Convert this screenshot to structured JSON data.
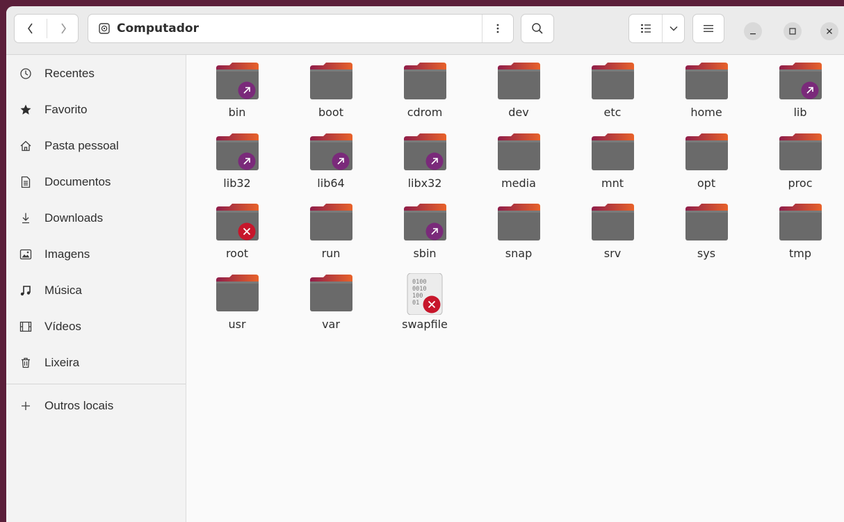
{
  "window": {
    "title": "Computador"
  },
  "header": {
    "back_icon": "chevron-left-icon",
    "forward_icon": "chevron-right-icon",
    "location_icon": "drive-icon",
    "title": "Computador",
    "more_icon": "kebab-menu-icon",
    "search_icon": "search-icon",
    "view_icon": "list-view-icon",
    "view_dropdown_icon": "chevron-down-icon",
    "menu_icon": "hamburger-menu-icon",
    "minimize_icon": "minimize-icon",
    "maximize_icon": "maximize-icon",
    "close_icon": "close-icon"
  },
  "sidebar": {
    "items": [
      {
        "label": "Recentes",
        "icon": "clock-icon"
      },
      {
        "label": "Favorito",
        "icon": "star-icon"
      },
      {
        "label": "Pasta pessoal",
        "icon": "home-icon"
      },
      {
        "label": "Documentos",
        "icon": "document-icon"
      },
      {
        "label": "Downloads",
        "icon": "download-icon"
      },
      {
        "label": "Imagens",
        "icon": "image-icon"
      },
      {
        "label": "Música",
        "icon": "music-icon"
      },
      {
        "label": "Vídeos",
        "icon": "video-icon"
      },
      {
        "label": "Lixeira",
        "icon": "trash-icon"
      }
    ],
    "other": {
      "label": "Outros locais",
      "icon": "plus-icon"
    }
  },
  "files": [
    {
      "name": "bin",
      "type": "folder",
      "emblem": "link"
    },
    {
      "name": "boot",
      "type": "folder",
      "emblem": ""
    },
    {
      "name": "cdrom",
      "type": "folder",
      "emblem": ""
    },
    {
      "name": "dev",
      "type": "folder",
      "emblem": ""
    },
    {
      "name": "etc",
      "type": "folder",
      "emblem": ""
    },
    {
      "name": "home",
      "type": "folder",
      "emblem": ""
    },
    {
      "name": "lib",
      "type": "folder",
      "emblem": "link"
    },
    {
      "name": "lib32",
      "type": "folder",
      "emblem": "link"
    },
    {
      "name": "lib64",
      "type": "folder",
      "emblem": "link"
    },
    {
      "name": "libx32",
      "type": "folder",
      "emblem": "link"
    },
    {
      "name": "media",
      "type": "folder",
      "emblem": ""
    },
    {
      "name": "mnt",
      "type": "folder",
      "emblem": ""
    },
    {
      "name": "opt",
      "type": "folder",
      "emblem": ""
    },
    {
      "name": "proc",
      "type": "folder",
      "emblem": ""
    },
    {
      "name": "root",
      "type": "folder",
      "emblem": "unreadable"
    },
    {
      "name": "run",
      "type": "folder",
      "emblem": ""
    },
    {
      "name": "sbin",
      "type": "folder",
      "emblem": "link"
    },
    {
      "name": "snap",
      "type": "folder",
      "emblem": ""
    },
    {
      "name": "srv",
      "type": "folder",
      "emblem": ""
    },
    {
      "name": "sys",
      "type": "folder",
      "emblem": ""
    },
    {
      "name": "tmp",
      "type": "folder",
      "emblem": ""
    },
    {
      "name": "usr",
      "type": "folder",
      "emblem": ""
    },
    {
      "name": "var",
      "type": "folder",
      "emblem": ""
    },
    {
      "name": "swapfile",
      "type": "binary",
      "emblem": "unreadable"
    }
  ],
  "colors": {
    "folder_body": "#6a6a6a",
    "folder_tab_start": "#8f1e4a",
    "folder_tab_end": "#e8622a",
    "link_emblem": "#7a2a7a",
    "unreadable_emblem": "#c7162b"
  }
}
